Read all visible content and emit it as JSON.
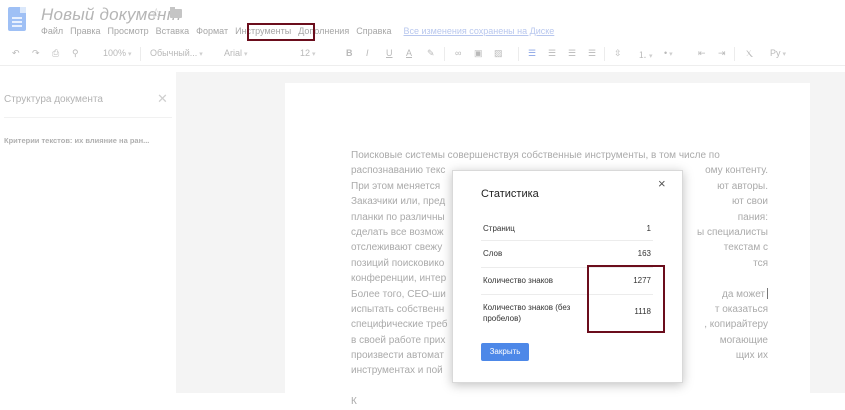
{
  "document": {
    "title": "Новый документ",
    "saved_status": "Все изменения сохранены на Диске"
  },
  "menu": [
    "Файл",
    "Правка",
    "Просмотр",
    "Вставка",
    "Формат",
    "Инструменты",
    "Дополнения",
    "Справка"
  ],
  "toolbar": {
    "zoom": "100%",
    "style": "Обычный...",
    "font": "Arial",
    "size": "12",
    "bold": "B",
    "italic": "I",
    "underline": "U",
    "text_color": "A",
    "clear_format": "Ⲭ",
    "input_tools": "Ру"
  },
  "outline": {
    "title": "Структура документа",
    "item": "Критерии текстов: их влияние на ран..."
  },
  "page": {
    "lines": [
      "Поисковые системы совершенствуя собственные инструменты, в том числе по",
      "распознаванию текс",
      "При этом меняется",
      "Заказчики или, пред",
      "планки по различны",
      "сделать все возмож",
      "отслеживают свежу",
      "позиций поисковико",
      "конференции, интер",
      "Более того, СЕО-ши",
      "испытать собственн",
      "специфические треб",
      "в своей работе прих",
      "произвести автомат",
      "инструментах и пой",
      "",
      "К"
    ],
    "right_fragments": [
      "",
      "ому контенту.",
      "ют авторы.",
      "ют свои",
      "пания:",
      "ы специалисты",
      "текстам с",
      "тся",
      "",
      "да может",
      "т оказаться",
      ", копирайтеру",
      "могающие",
      "щих их",
      "",
      "",
      ""
    ]
  },
  "dialog": {
    "title": "Статистика",
    "close": "×",
    "rows": [
      {
        "label": "Страниц",
        "value": "1"
      },
      {
        "label": "Слов",
        "value": "163"
      },
      {
        "label": "Количество знаков",
        "value": "1277"
      },
      {
        "label": "Количество знаков (без пробелов)",
        "value": "1118"
      }
    ],
    "button": "Закрыть"
  }
}
